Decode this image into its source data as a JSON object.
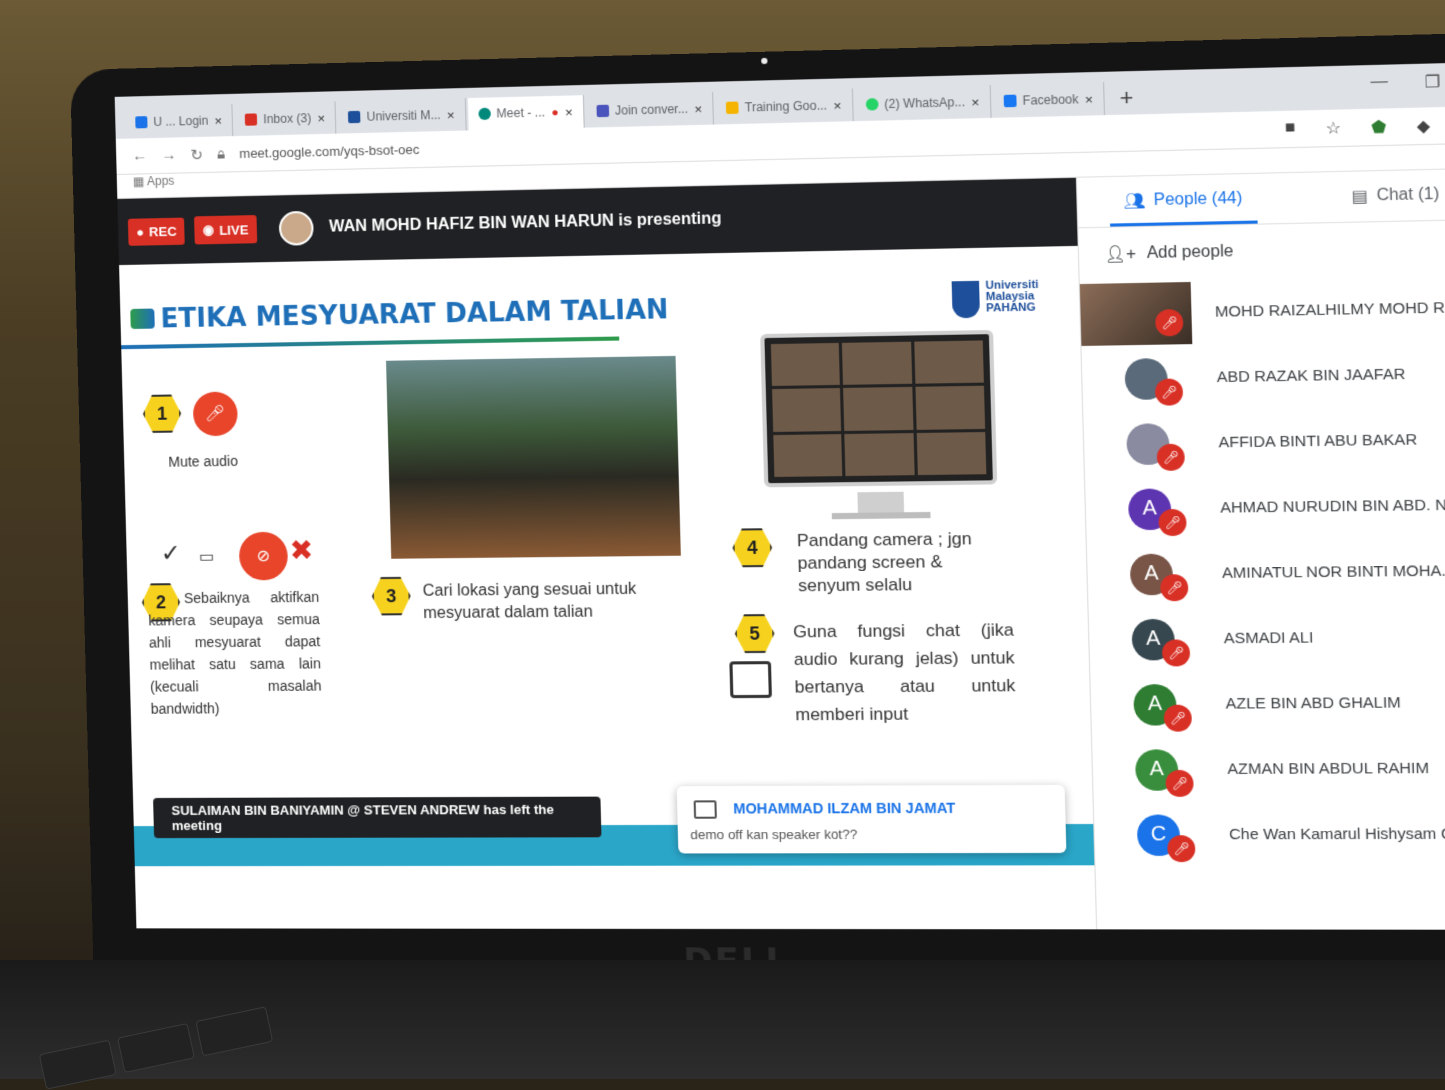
{
  "browser": {
    "tabs": [
      {
        "label": "U ... Login",
        "color": "#1a73e8"
      },
      {
        "label": "Inbox (3)",
        "color": "#d93025"
      },
      {
        "label": "Universiti M...",
        "color": "#1e4f9a"
      },
      {
        "label": "Meet - ...",
        "color": "#00897b"
      },
      {
        "label": "Join conver...",
        "color": "#4b53bc"
      },
      {
        "label": "Training Goo...",
        "color": "#f4b400"
      },
      {
        "label": "(2) WhatsAp...",
        "color": "#25d366"
      },
      {
        "label": "Facebook",
        "color": "#1877f2"
      }
    ],
    "new_tab": "+",
    "url": "meet.google.com/yqs-bsot-oec",
    "bookmarks_label": "Apps"
  },
  "meet": {
    "rec_label": "REC",
    "live_label": "LIVE",
    "presenting_text": "WAN MOHD HAFIZ BIN WAN HARUN is presenting"
  },
  "slide": {
    "title": "ETIKA MESYUARAT DALAM TALIAN",
    "univ_line1": "Universiti",
    "univ_line2": "Malaysia",
    "univ_line3": "PAHANG",
    "step1_num": "1",
    "step1_text": "Mute audio",
    "step2_num": "2",
    "step2_text": "Sebaiknya aktifkan kamera seupaya semua ahli mesyuarat dapat melihat satu sama lain (kecuali masalah bandwidth)",
    "step3_num": "3",
    "step3_text": "Cari lokasi yang sesuai untuk mesyuarat dalam talian",
    "step4_num": "4",
    "step4_text": "Pandang camera ; jgn pandang screen & senyum selalu",
    "step5_num": "5",
    "step5_text": "Guna fungsi chat (jika audio kurang jelas) untuk bertanya atau untuk memberi input",
    "check": "✓",
    "cross": "✖"
  },
  "toast": "SULAIMAN BIN BANIYAMIN @ STEVEN ANDREW has left the meeting",
  "chat_popup": {
    "name": "MOHAMMAD ILZAM BIN JAMAT",
    "message": "demo off kan speaker kot??"
  },
  "panel": {
    "people_tab": "People (44)",
    "chat_tab": "Chat (1)",
    "add_people": "Add people",
    "participants": [
      {
        "name": "MOHD RAIZALHILMY MOHD R...",
        "initial": "",
        "color": "#7a6a58"
      },
      {
        "name": "ABD RAZAK BIN JAAFAR",
        "initial": "",
        "color": "#5a6a7a"
      },
      {
        "name": "AFFIDA BINTI ABU BAKAR",
        "initial": "",
        "color": "#8a8aa0"
      },
      {
        "name": "AHMAD NURUDIN BIN ABD. N...",
        "initial": "A",
        "color": "#5e35b1"
      },
      {
        "name": "AMINATUL NOR BINTI MOHA...",
        "initial": "A",
        "color": "#795548"
      },
      {
        "name": "ASMADI ALI",
        "initial": "A",
        "color": "#37474f"
      },
      {
        "name": "AZLE BIN ABD GHALIM",
        "initial": "A",
        "color": "#2e7d32"
      },
      {
        "name": "AZMAN BIN ABDUL RAHIM",
        "initial": "A",
        "color": "#388e3c"
      },
      {
        "name": "Che Wan Kamarul Hishysam C...",
        "initial": "C",
        "color": "#1a73e8"
      }
    ]
  },
  "laptop_brand": "DELL"
}
